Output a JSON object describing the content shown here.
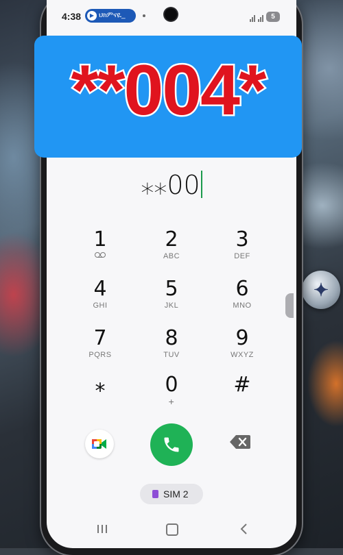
{
  "status_bar": {
    "time": "4:38",
    "notification_pill": "ህክምናዪ_",
    "battery": "5"
  },
  "banner": {
    "text": "**004*"
  },
  "dialer": {
    "input_value": "⁎⁎00",
    "keys": [
      {
        "digit": "1",
        "letters": ""
      },
      {
        "digit": "2",
        "letters": "ABC"
      },
      {
        "digit": "3",
        "letters": "DEF"
      },
      {
        "digit": "4",
        "letters": "GHI"
      },
      {
        "digit": "5",
        "letters": "JKL"
      },
      {
        "digit": "6",
        "letters": "MNO"
      },
      {
        "digit": "7",
        "letters": "PQRS"
      },
      {
        "digit": "8",
        "letters": "TUV"
      },
      {
        "digit": "9",
        "letters": "WXYZ"
      },
      {
        "digit": "⁎",
        "letters": ""
      },
      {
        "digit": "0",
        "letters": "+"
      },
      {
        "digit": "#",
        "letters": ""
      }
    ],
    "sim_label": "SIM 2"
  },
  "colors": {
    "banner_bg": "#2196f3",
    "banner_text": "#e0141e",
    "call_green": "#1fb256",
    "caret": "#1a9a4b",
    "sim_icon": "#8e4fd6"
  },
  "icons": [
    "voicemail-icon",
    "google-meet-icon",
    "phone-icon",
    "backspace-icon",
    "sim-card-icon",
    "recents-icon",
    "home-icon",
    "back-icon"
  ]
}
